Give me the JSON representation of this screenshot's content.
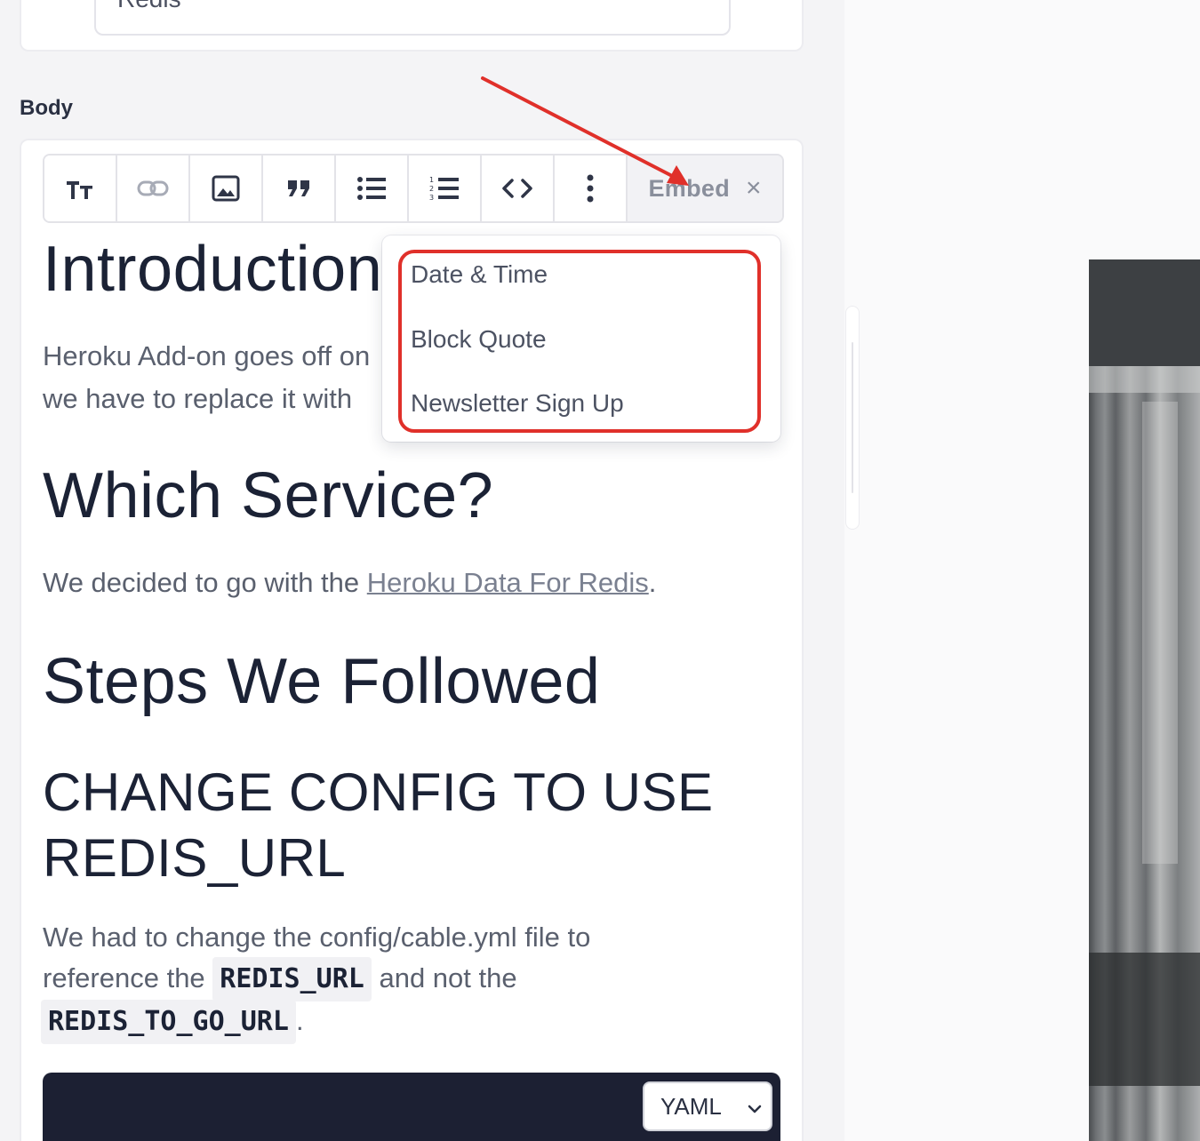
{
  "title_field": {
    "value": "Redis"
  },
  "body_label": "Body",
  "toolbar": {
    "buttons": [
      "text-size-icon",
      "link-icon",
      "image-icon",
      "quote-icon",
      "bullet-list-icon",
      "numbered-list-icon",
      "code-icon",
      "more-icon"
    ],
    "embed_label": "Embed",
    "close_glyph": "×"
  },
  "dropdown": {
    "items": [
      "Date & Time",
      "Block Quote",
      "Newsletter Sign Up"
    ]
  },
  "content": {
    "h1_intro": "Introduction",
    "intro_line1": "Heroku Add-on goes off on",
    "intro_line2": "we have to replace it with",
    "h1_service": "Which Service?",
    "service_text": "We decided to go with the ",
    "service_link": "Heroku Data For Redis",
    "service_end": ".",
    "h1_steps": "Steps We Followed",
    "h2_change": "CHANGE CONFIG TO USE REDIS_URL",
    "change_text1": "We had to change the config/cable.yml file to",
    "change_text2a": "reference the ",
    "change_code1": "REDIS_URL",
    "change_text2b": " and not the",
    "change_code2": "REDIS_TO_GO_URL",
    "change_end": ".",
    "code_language": "YAML"
  },
  "colors": {
    "annotation": "#e0302a",
    "code_bg": "#1c2033"
  }
}
